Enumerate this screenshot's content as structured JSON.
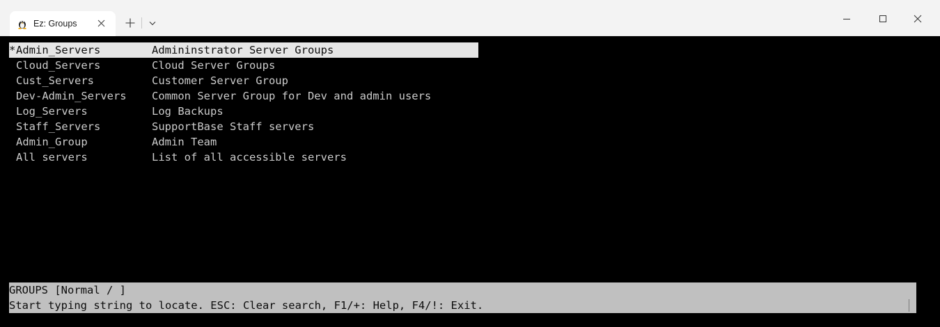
{
  "tab": {
    "title": "Ez: Groups",
    "icon": "linux-tux-icon"
  },
  "window_controls": {
    "minimize": "–",
    "maximize": "□",
    "close": "✕"
  },
  "groups": [
    {
      "marker": "*",
      "name": "Admin_Servers",
      "description": "Admininstrator Server Groups",
      "selected": true
    },
    {
      "marker": "",
      "name": "Cloud_Servers",
      "description": "Cloud Server Groups",
      "selected": false
    },
    {
      "marker": "",
      "name": "Cust_Servers",
      "description": "Customer Server Group",
      "selected": false
    },
    {
      "marker": "",
      "name": "Dev-Admin_Servers",
      "description": "Common Server Group for Dev and admin users",
      "selected": false
    },
    {
      "marker": "",
      "name": "Log_Servers",
      "description": "Log Backups",
      "selected": false
    },
    {
      "marker": "",
      "name": "Staff_Servers",
      "description": "SupportBase Staff servers",
      "selected": false
    },
    {
      "marker": "",
      "name": "Admin_Group",
      "description": "Admin Team",
      "selected": false
    },
    {
      "marker": "",
      "name": "All servers",
      "description": "List of all accessible servers",
      "selected": false
    }
  ],
  "status": {
    "mode_line": "GROUPS [Normal / ]",
    "help_line": "Start typing string to locate. ESC: Clear search, F1/+: Help, F4/!: Exit."
  },
  "colors": {
    "terminal_bg": "#000000",
    "terminal_fg": "#cccccc",
    "selection_bg": "#e6e6e6",
    "status_bg": "#c0c0c0",
    "titlebar_bg": "#f3f3f3"
  }
}
